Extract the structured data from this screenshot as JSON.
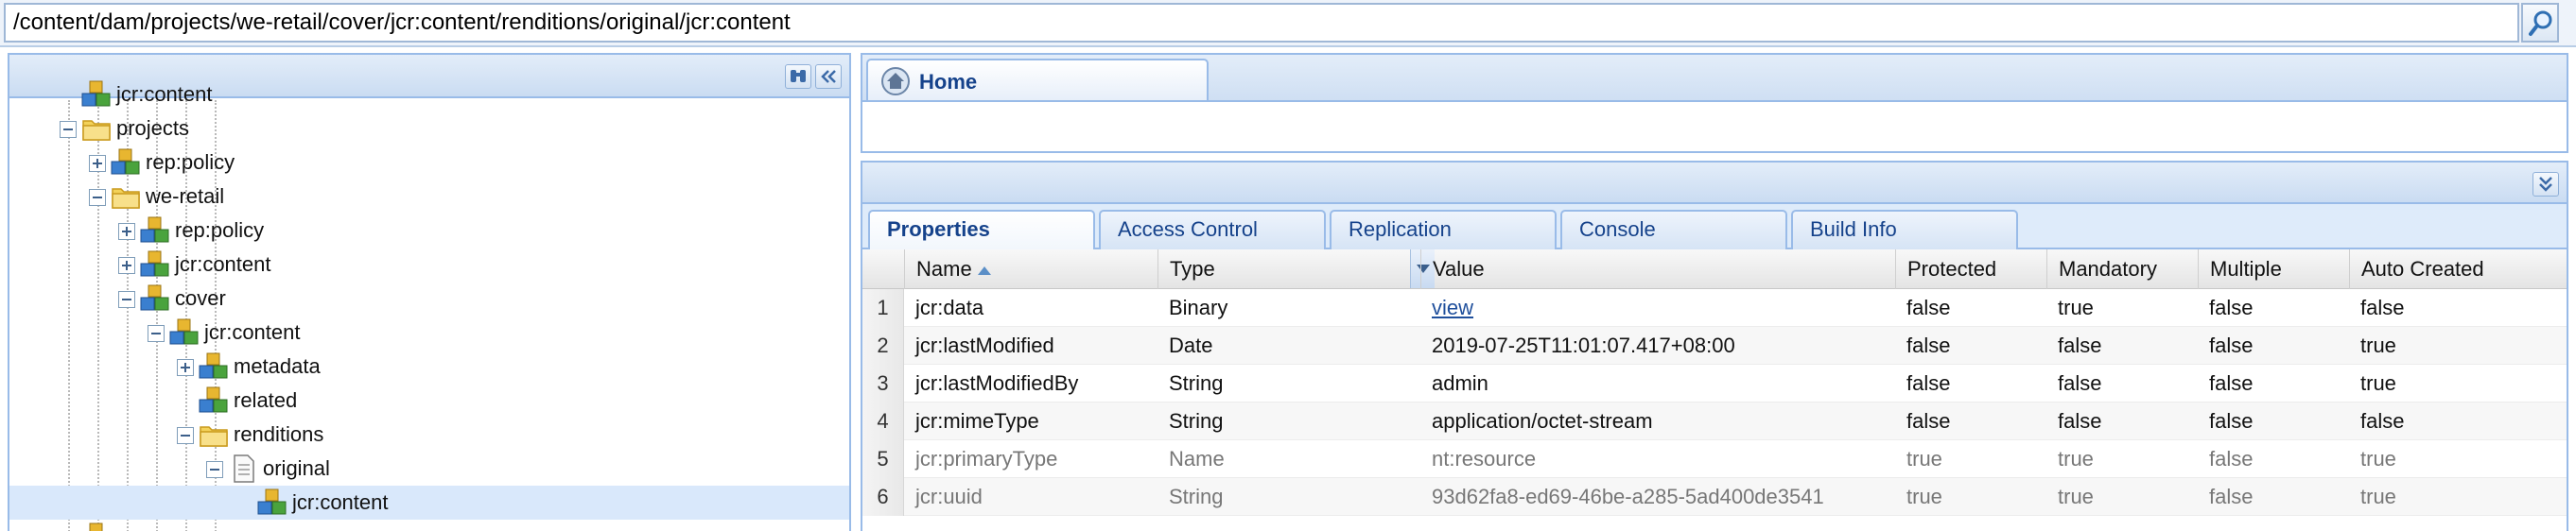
{
  "path_bar": {
    "path": "/content/dam/projects/we-retail/cover/jcr:content/renditions/original/jcr:content"
  },
  "tree": {
    "partial_top_label": "jcr:content",
    "nodes": [
      {
        "label": "projects",
        "toggle": "minus",
        "icon": "folder",
        "level": 3
      },
      {
        "label": "rep:policy",
        "toggle": "plus",
        "icon": "node",
        "level": 4
      },
      {
        "label": "we-retail",
        "toggle": "minus",
        "icon": "folder",
        "level": 4
      },
      {
        "label": "rep:policy",
        "toggle": "plus",
        "icon": "node",
        "level": 5
      },
      {
        "label": "jcr:content",
        "toggle": "plus",
        "icon": "node",
        "level": 5
      },
      {
        "label": "cover",
        "toggle": "minus",
        "icon": "node",
        "level": 5
      },
      {
        "label": "jcr:content",
        "toggle": "minus",
        "icon": "node",
        "level": 6
      },
      {
        "label": "metadata",
        "toggle": "plus",
        "icon": "node",
        "level": 7
      },
      {
        "label": "related",
        "toggle": "none",
        "icon": "node",
        "level": 7
      },
      {
        "label": "renditions",
        "toggle": "minus",
        "icon": "folder",
        "level": 7
      },
      {
        "label": "original",
        "toggle": "minus",
        "icon": "file",
        "level": 8
      },
      {
        "label": "jcr:content",
        "toggle": "none",
        "icon": "node",
        "level": 9,
        "selected": true
      }
    ]
  },
  "main_tab": {
    "label": "Home"
  },
  "detail_tabs": [
    "Properties",
    "Access Control",
    "Replication",
    "Console",
    "Build Info"
  ],
  "properties_grid": {
    "columns": [
      "Name",
      "Type",
      "Value",
      "Protected",
      "Mandatory",
      "Multiple",
      "Auto Created"
    ],
    "rows": [
      {
        "num": "1",
        "name": "jcr:data",
        "type": "Binary",
        "value": "view",
        "protected": "false",
        "mandatory": "true",
        "multiple": "false",
        "auto_created": "false",
        "value_is_link": true,
        "muted": false
      },
      {
        "num": "2",
        "name": "jcr:lastModified",
        "type": "Date",
        "value": "2019-07-25T11:01:07.417+08:00",
        "protected": "false",
        "mandatory": "false",
        "multiple": "false",
        "auto_created": "true",
        "muted": false
      },
      {
        "num": "3",
        "name": "jcr:lastModifiedBy",
        "type": "String",
        "value": "admin",
        "protected": "false",
        "mandatory": "false",
        "multiple": "false",
        "auto_created": "true",
        "muted": false
      },
      {
        "num": "4",
        "name": "jcr:mimeType",
        "type": "String",
        "value": "application/octet-stream",
        "protected": "false",
        "mandatory": "false",
        "multiple": "false",
        "auto_created": "false",
        "muted": false
      },
      {
        "num": "5",
        "name": "jcr:primaryType",
        "type": "Name",
        "value": "nt:resource",
        "protected": "true",
        "mandatory": "true",
        "multiple": "false",
        "auto_created": "true",
        "muted": true
      },
      {
        "num": "6",
        "name": "jcr:uuid",
        "type": "String",
        "value": "93d62fa8-ed69-46be-a285-5ad400de3541",
        "protected": "true",
        "mandatory": "true",
        "multiple": "false",
        "auto_created": "true",
        "muted": true
      }
    ]
  },
  "colors": {
    "panel_border": "#99bbe8",
    "header_text": "#15428b",
    "selected_row": "#d9e8fb",
    "link": "#1f4f9c"
  }
}
